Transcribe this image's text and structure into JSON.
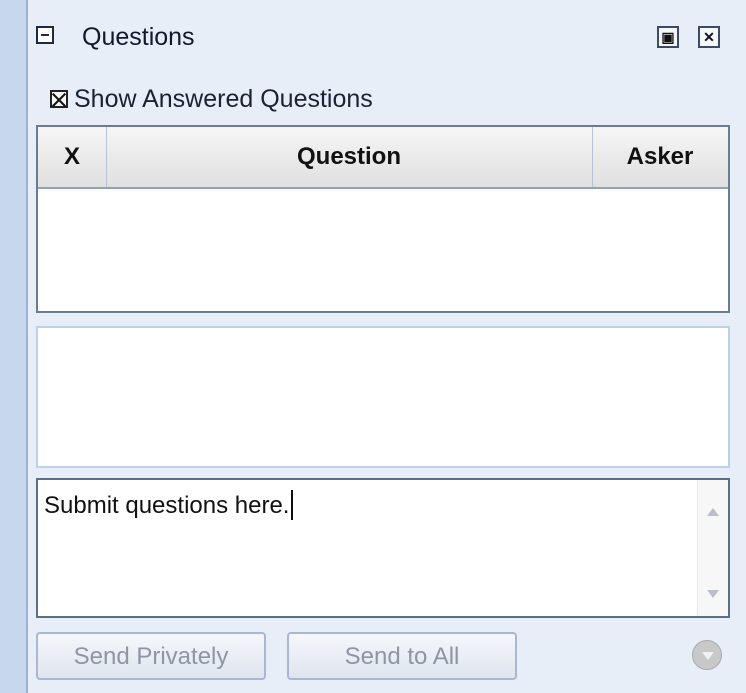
{
  "panel": {
    "title": "Questions"
  },
  "options": {
    "show_answered_label": "Show Answered Questions",
    "show_answered_checked": true
  },
  "table": {
    "headers": [
      "X",
      "Question",
      "Asker"
    ],
    "rows": []
  },
  "input": {
    "value": "Submit questions here."
  },
  "buttons": {
    "send_privately": "Send Privately",
    "send_to_all": "Send to All"
  },
  "icons": {
    "collapse": "collapse-icon",
    "restore": "restore-icon",
    "close": "close-icon",
    "dropdown": "chevron-down-icon"
  }
}
